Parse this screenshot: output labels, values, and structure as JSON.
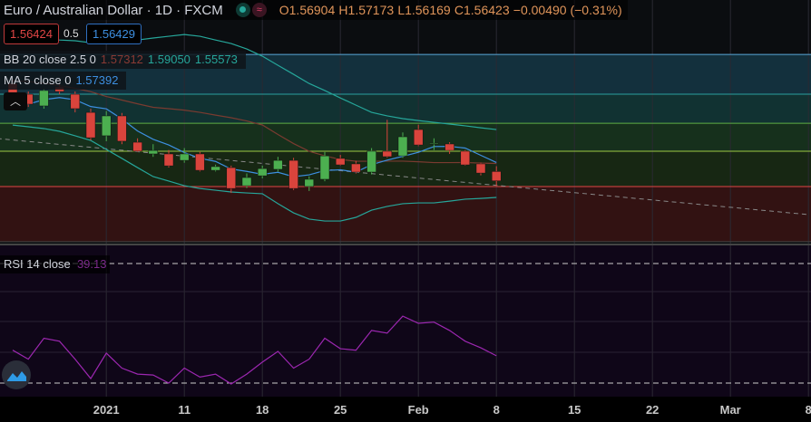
{
  "header": {
    "title": "Euro / Australian Dollar · 1D · FXCM",
    "open": "O1.56904",
    "high": "H1.57173",
    "low": "L1.56169",
    "close": "C1.56423",
    "change": "−0.00490 (−0.31%)",
    "status_icon": "market-open-dot-icon",
    "wave_icon": "wave-icon"
  },
  "trade": {
    "sell": "1.56424",
    "spread": "0.5",
    "buy": "1.56429"
  },
  "legends": {
    "bb_label": "BB 20 close 2.5 0",
    "bb_basis": "1.57312",
    "bb_upper": "1.59050",
    "bb_lower": "1.55573",
    "ma_label": "MA 5 close 0",
    "ma_value": "1.57392",
    "rsi_label": "RSI 14 close",
    "rsi_value": "39.13"
  },
  "colors": {
    "up": "#4caf50",
    "down": "#d9443c",
    "bb_band": "#26a69a",
    "bb_basis": "#7a3b30",
    "ma": "#3d8fe0",
    "rsi": "#9c27b0"
  },
  "chart_data": {
    "type": "candlestick",
    "ylim": [
      1.5325,
      1.6569
    ],
    "candles": [
      [
        1.6142,
        1.616,
        1.6021,
        1.6035
      ],
      [
        1.6086,
        1.61,
        1.6021,
        1.6035
      ],
      [
        1.6026,
        1.6115,
        1.6012,
        1.6105
      ],
      [
        1.6123,
        1.614,
        1.6086,
        1.61
      ],
      [
        1.6086,
        1.61,
        1.5993,
        1.6012
      ],
      [
        1.5993,
        1.6012,
        1.585,
        1.5863
      ],
      [
        1.5873,
        1.6,
        1.5845,
        1.5975
      ],
      [
        1.5975,
        1.599,
        1.583,
        1.5845
      ],
      [
        1.584,
        1.586,
        1.579,
        1.5794
      ],
      [
        1.578,
        1.583,
        1.5765,
        1.5798
      ],
      [
        1.578,
        1.58,
        1.571,
        1.5719
      ],
      [
        1.5747,
        1.581,
        1.5735,
        1.578
      ],
      [
        1.578,
        1.579,
        1.569,
        1.5696
      ],
      [
        1.5696,
        1.5725,
        1.569,
        1.5715
      ],
      [
        1.571,
        1.572,
        1.558,
        1.5603
      ],
      [
        1.5617,
        1.568,
        1.5605,
        1.5659
      ],
      [
        1.5668,
        1.572,
        1.5655,
        1.5705
      ],
      [
        1.5701,
        1.5765,
        1.569,
        1.5747
      ],
      [
        1.5747,
        1.576,
        1.5595,
        1.5603
      ],
      [
        1.5613,
        1.5665,
        1.559,
        1.565
      ],
      [
        1.565,
        1.579,
        1.564,
        1.577
      ],
      [
        1.5757,
        1.5775,
        1.572,
        1.5724
      ],
      [
        1.5729,
        1.5745,
        1.568,
        1.5687
      ],
      [
        1.5687,
        1.581,
        1.5675,
        1.5794
      ],
      [
        1.5794,
        1.5955,
        1.576,
        1.5766
      ],
      [
        1.577,
        1.589,
        1.576,
        1.5868
      ],
      [
        1.5905,
        1.593,
        1.582,
        1.5826
      ],
      [
        1.5831,
        1.586,
        1.58,
        1.5835
      ],
      [
        1.5831,
        1.584,
        1.578,
        1.5798
      ],
      [
        1.5794,
        1.58,
        1.572,
        1.5724
      ],
      [
        1.5729,
        1.5735,
        1.567,
        1.5682
      ],
      [
        1.569,
        1.5717,
        1.5617,
        1.5642
      ]
    ],
    "bb_upper": [
      1.6383,
      1.6383,
      1.6374,
      1.6364,
      1.636,
      1.635,
      1.6346,
      1.6355,
      1.6364,
      1.6374,
      1.6383,
      1.6392,
      1.6383,
      1.6364,
      1.6346,
      1.6318,
      1.6281,
      1.6234,
      1.6188,
      1.6141,
      1.6105,
      1.6067,
      1.603,
      1.5993,
      1.5975,
      1.5961,
      1.5951,
      1.5942,
      1.5933,
      1.5924,
      1.5914,
      1.5905
    ],
    "bb_lower": [
      1.5928,
      1.5919,
      1.591,
      1.5896,
      1.5873,
      1.5849,
      1.5803,
      1.5757,
      1.571,
      1.5664,
      1.5641,
      1.5617,
      1.5603,
      1.5594,
      1.5585,
      1.558,
      1.5576,
      1.5525,
      1.5478,
      1.5446,
      1.5436,
      1.5436,
      1.5455,
      1.5492,
      1.5511,
      1.5525,
      1.5529,
      1.5529,
      1.5538,
      1.5548,
      1.5552,
      1.5557
    ],
    "rsi": [
      41,
      38,
      45,
      44,
      38,
      31.5,
      40,
      35,
      33,
      32.7,
      30,
      35,
      32,
      33,
      29.7,
      33,
      37,
      40.6,
      35,
      38,
      45,
      41.5,
      41,
      47.6,
      46.7,
      52.4,
      50,
      50.4,
      47.6,
      44,
      41.8,
      39.13
    ],
    "rsi_levels": [
      70,
      30
    ],
    "levels": [
      {
        "price": 1.629,
        "color": "#5aa8d8",
        "fill": "#13303d"
      },
      {
        "price": 1.6086,
        "color": "#2aa0a0",
        "fill": "#113232"
      },
      {
        "price": 1.5937,
        "color": "#5fae45",
        "fill": "#16301c"
      },
      {
        "price": 1.5794,
        "color": "#9cc845",
        "fill": "#172713"
      },
      {
        "price": 1.5613,
        "color": "#e04545",
        "fill": "#321212"
      }
    ],
    "levels_bottom": 1.533,
    "trendline": {
      "from": [
        -1,
        1.5859
      ],
      "to": [
        51,
        1.5469
      ]
    },
    "x_ticks": [
      {
        "label": "2021",
        "index": 6
      },
      {
        "label": "11",
        "index": 11
      },
      {
        "label": "18",
        "index": 16
      },
      {
        "label": "25",
        "index": 21
      },
      {
        "label": "Feb",
        "index": 26
      },
      {
        "label": "8",
        "index": 31
      },
      {
        "label": "15",
        "index": 36
      },
      {
        "label": "22",
        "index": 41
      },
      {
        "label": "Mar",
        "index": 46
      },
      {
        "label": "8",
        "index": 51
      }
    ]
  }
}
